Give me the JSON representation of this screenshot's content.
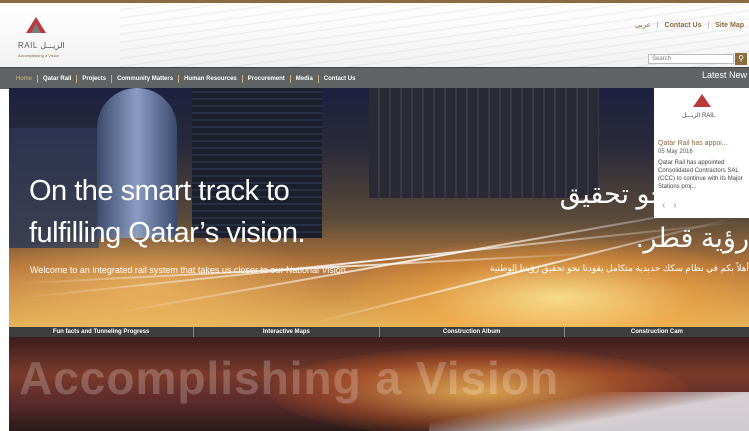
{
  "header": {
    "logo_text": "RAIL الريـــل",
    "logo_sub": "Accomplishing a Vision",
    "toplinks": {
      "arabic": "عربي",
      "contact": "Contact Us",
      "sitemap": "Site Map"
    },
    "search_placeholder": "Search"
  },
  "nav": {
    "items": [
      "Home",
      "Qatar Rail",
      "Projects",
      "Community Matters",
      "Human Resources",
      "Procurement",
      "Media",
      "Contact Us"
    ],
    "active_index": 0
  },
  "latest_news": {
    "title": "Latest New",
    "logo_text": "الريـــل RAIL",
    "headline": "Qatar Rail has appoi...",
    "date": "05 May 2016",
    "body": "Qatar Rail has appointed Consolidated Contractors SAL (CCC) to continue with its Major Stations proj..."
  },
  "hero": {
    "line1": "On the smart track to",
    "line2": "fulfilling Qatar’s vision.",
    "subtitle": "Welcome to an integrated rail system that takes us closer to our National Vision.",
    "ar_line1": "طليعة نحو تحقيق",
    "ar_line2": "رؤية قطر.",
    "ar_subtitle": "أهلاً بكم في نظام سكك حديدية متكامل يقودنا نحو تحقيق رؤيتنا الوطنية"
  },
  "tabs": [
    "Fun facts and Tunneling Progress",
    "Interactive Maps",
    "Construction Album",
    "Construction Cam"
  ],
  "banner": {
    "slogan": "Accomplishing a Vision"
  },
  "colors": {
    "accent": "#8a6a3f",
    "nav_bg": "#5f6363",
    "logo_red": "#b83a3a"
  }
}
